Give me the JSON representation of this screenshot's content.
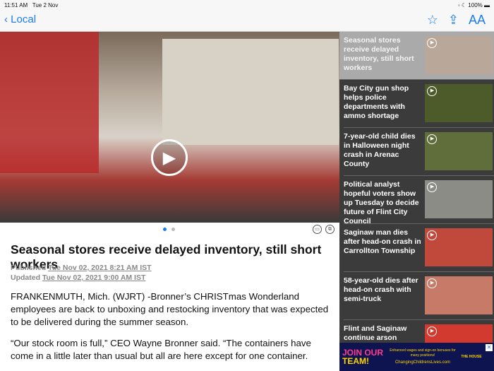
{
  "status": {
    "time": "11:51 AM",
    "date": "Tue 2 Nov",
    "battery": "100%"
  },
  "nav": {
    "back_label": "Local",
    "icons": [
      "star-icon",
      "share-icon",
      "text-size-icon"
    ],
    "text_size_label": "AA"
  },
  "article": {
    "title": "Seasonal stores receive delayed inventory, still short workers",
    "published_label": "Published",
    "published": "Tue Nov 02, 2021 8:21 AM IST",
    "updated_label": "Updated",
    "updated": "Tue Nov 02, 2021 9:00 AM IST",
    "paragraphs": [
      "FRANKENMUTH, Mich. (WJRT) -Bronner’s CHRISTmas Wonderland employees are back to unboxing and restocking inventory that was expected to be delivered during the summer season.",
      "“Our stock room is full,” CEO Wayne Bronner said. “The containers have come in a little later than usual but all are here except for one container."
    ]
  },
  "carousel": {
    "pages": 2,
    "current": 1
  },
  "sidebar": {
    "items": [
      {
        "title": "Seasonal stores receive delayed inventory, still short workers",
        "color": "#b9a79a"
      },
      {
        "title": "Bay City gun shop helps police departments with ammo shortage",
        "color": "#4d5a2a"
      },
      {
        "title": "7-year-old child dies in Halloween night crash in Arenac County",
        "color": "#5f6e3a"
      },
      {
        "title": "Political analyst hopeful voters show up Tuesday to decide future of Flint City Council",
        "color": "#8c8c86"
      },
      {
        "title": "Saginaw man dies after head-on crash in Carrollton Township",
        "color": "#c0493c"
      },
      {
        "title": "58-year-old dies after head-on crash with semi-truck",
        "color": "#c87a68"
      },
      {
        "title": "Flint and Saginaw continue arson watches",
        "color": "#d23a30"
      }
    ]
  },
  "ad": {
    "headline_1": "JOIN OUR",
    "headline_2": "TEAM!",
    "message": "Enhanced wages and sign-on bonuses for many positions!",
    "url": "ChangingChildrensLives.com",
    "brand": "THE HOUSE",
    "close": "✕"
  }
}
